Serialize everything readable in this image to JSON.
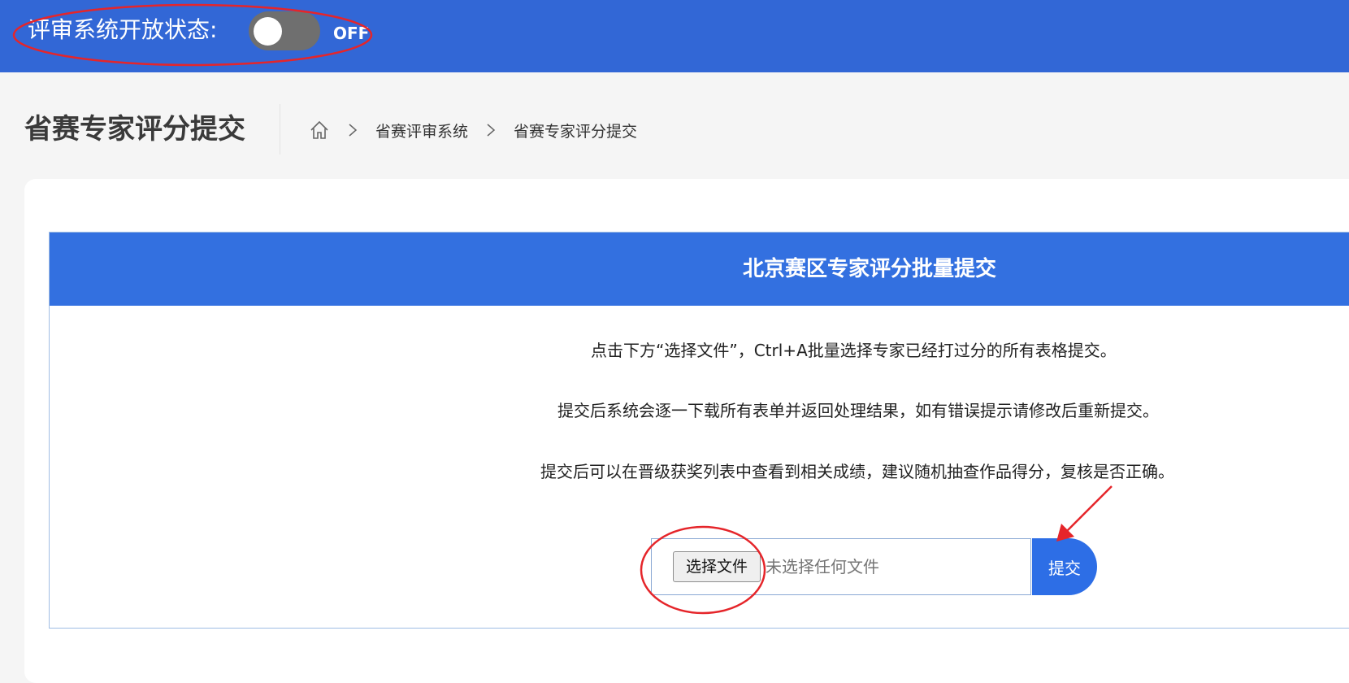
{
  "header": {
    "status_label": "评审系统开放状态:",
    "toggle_state": "OFF"
  },
  "page": {
    "title": "省赛专家评分提交",
    "breadcrumb": [
      "省赛评审系统",
      "省赛专家评分提交"
    ]
  },
  "panel": {
    "title": "北京赛区专家评分批量提交",
    "instructions": [
      "点击下方“选择文件”，Ctrl+A批量选择专家已经打过分的所有表格提交。",
      "提交后系统会逐一下载所有表单并返回处理结果，如有错误提示请修改后重新提交。",
      "提交后可以在晋级获奖列表中查看到相关成绩，建议随机抽查作品得分，复核是否正确。"
    ],
    "file_button_label": "选择文件",
    "file_status": "未选择任何文件",
    "submit_label": "提交"
  },
  "colors": {
    "topbar": "#3267d6",
    "panel_header": "#3370e0",
    "submit": "#2d6ee6",
    "annotation": "#e5252a"
  },
  "icons": [
    "home-icon",
    "chevron-right-icon",
    "annotation-arrow-icon"
  ]
}
